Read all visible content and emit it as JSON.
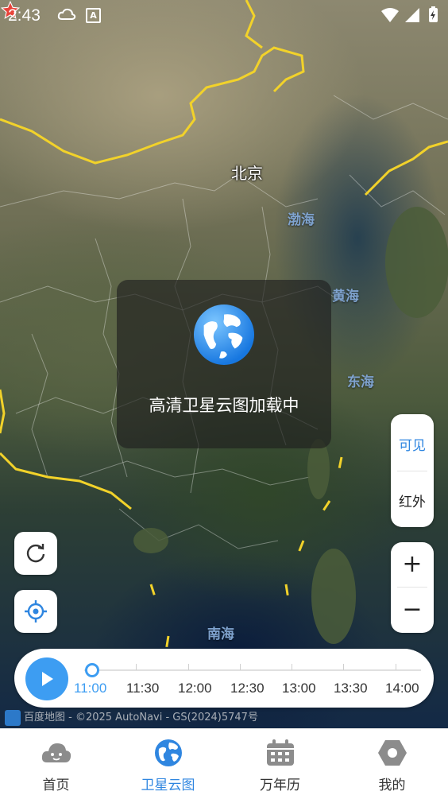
{
  "status_bar": {
    "time": "2:43"
  },
  "map": {
    "city": "北京",
    "seas": {
      "bohai": "渤海",
      "huanghai": "黄海",
      "donghai": "东海",
      "nanhai": "南海"
    },
    "attribution": "百度地图 - ©2025 AutoNavi - GS(2024)5747号"
  },
  "loading": {
    "text": "高清卫星云图加载中"
  },
  "layer_toggle": {
    "visible": "可见",
    "infrared": "红外",
    "active": "可见"
  },
  "zoom": {
    "in": "+",
    "out": "−"
  },
  "timeline": {
    "times": [
      "11:00",
      "11:30",
      "12:00",
      "12:30",
      "13:00",
      "13:30",
      "14:00"
    ],
    "current": "11:00"
  },
  "tabs": [
    {
      "label": "首页",
      "icon": "cloud-face-icon"
    },
    {
      "label": "卫星云图",
      "icon": "globe-icon"
    },
    {
      "label": "万年历",
      "icon": "calendar-icon"
    },
    {
      "label": "我的",
      "icon": "hexagon-settings-icon"
    }
  ],
  "active_tab": "卫星云图",
  "colors": {
    "accent": "#3d9df2",
    "border_yellow": "#f2d22a"
  }
}
